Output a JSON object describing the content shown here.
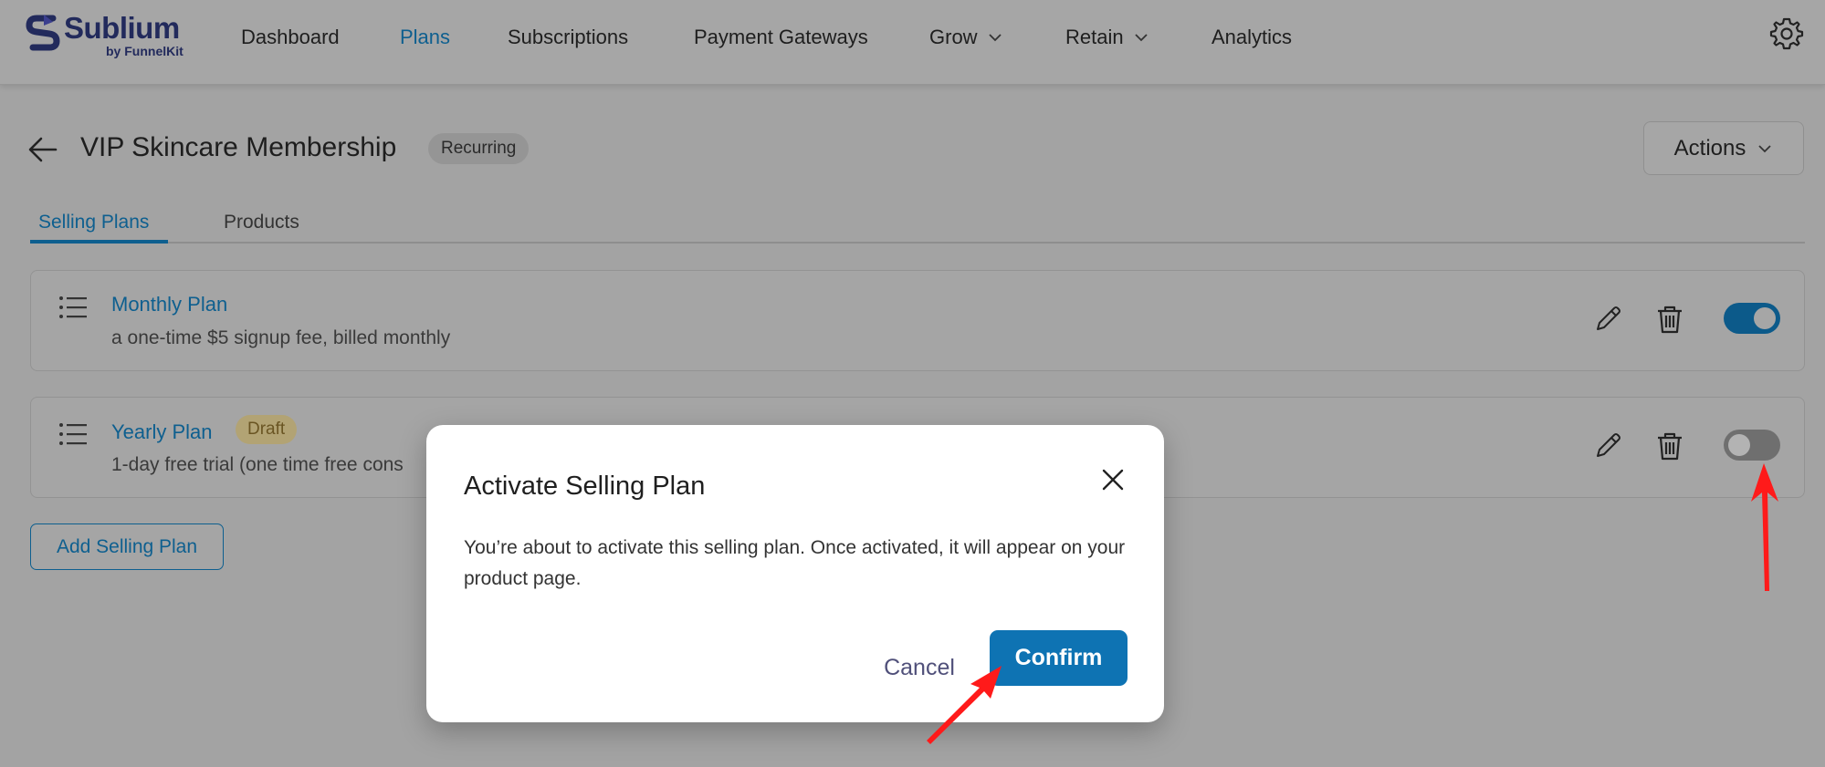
{
  "brand": {
    "name": "Sublium",
    "by": "by ",
    "by_brand": "FunnelKit"
  },
  "nav": [
    {
      "label": "Dashboard",
      "active": false
    },
    {
      "label": "Plans",
      "active": true
    },
    {
      "label": "Subscriptions",
      "active": false
    },
    {
      "label": "Payment Gateways",
      "active": false
    },
    {
      "label": "Grow",
      "active": false,
      "dropdown": true
    },
    {
      "label": "Retain",
      "active": false,
      "dropdown": true
    },
    {
      "label": "Analytics",
      "active": false
    }
  ],
  "header": {
    "title": "VIP Skincare Membership",
    "badge": "Recurring",
    "actions_label": "Actions"
  },
  "tabs": [
    {
      "label": "Selling Plans",
      "active": true
    },
    {
      "label": "Products",
      "active": false
    }
  ],
  "plans": [
    {
      "name": "Monthly Plan",
      "description": "a one-time $5 signup fee, billed monthly",
      "badge": "",
      "enabled": true
    },
    {
      "name": "Yearly Plan",
      "description": "1-day free trial (one time free cons",
      "badge": "Draft",
      "enabled": false
    }
  ],
  "add_plan_label": "Add Selling Plan",
  "modal": {
    "title": "Activate Selling Plan",
    "text": "You’re about to activate this selling plan. Once activated, it will appear on your product page.",
    "cancel_label": "Cancel",
    "confirm_label": "Confirm"
  },
  "colors": {
    "accent": "#0e73b3",
    "link": "#0e5f8f",
    "annotation": "#ff1a1a"
  },
  "icons": [
    "sublium-logo-icon",
    "chevron-down-icon",
    "gear-icon",
    "arrow-left-icon",
    "drag-list-icon",
    "pencil-icon",
    "trash-icon",
    "close-icon"
  ]
}
